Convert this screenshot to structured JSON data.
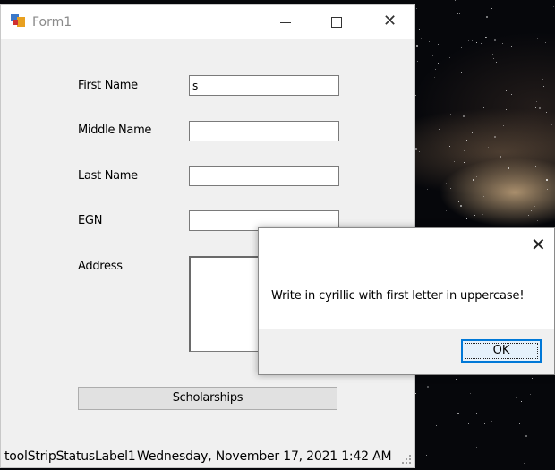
{
  "window": {
    "title": "Form1",
    "icon": "winforms-app-icon",
    "controls": [
      "minimize-icon",
      "maximize-icon",
      "close-icon"
    ]
  },
  "form": {
    "fields": [
      {
        "label": "First Name",
        "value": "s"
      },
      {
        "label": "Middle Name",
        "value": ""
      },
      {
        "label": "Last Name",
        "value": ""
      },
      {
        "label": "EGN",
        "value": ""
      }
    ],
    "address_label": "Address",
    "address_value": "",
    "button_label": "Scholarships"
  },
  "status_bar": {
    "label1": "toolStripStatusLabel1",
    "label2": "Wednesday, November 17, 2021  1:42 AM"
  },
  "message_box": {
    "text": "Write in cyrillic with first letter in uppercase!",
    "ok_label": "OK",
    "close_glyph": "✕"
  },
  "glyphs": {
    "close": "✕"
  },
  "colors": {
    "form_bg": "#f0f0f0",
    "accent": "#0078d7",
    "title_text": "#8a8a8a"
  }
}
